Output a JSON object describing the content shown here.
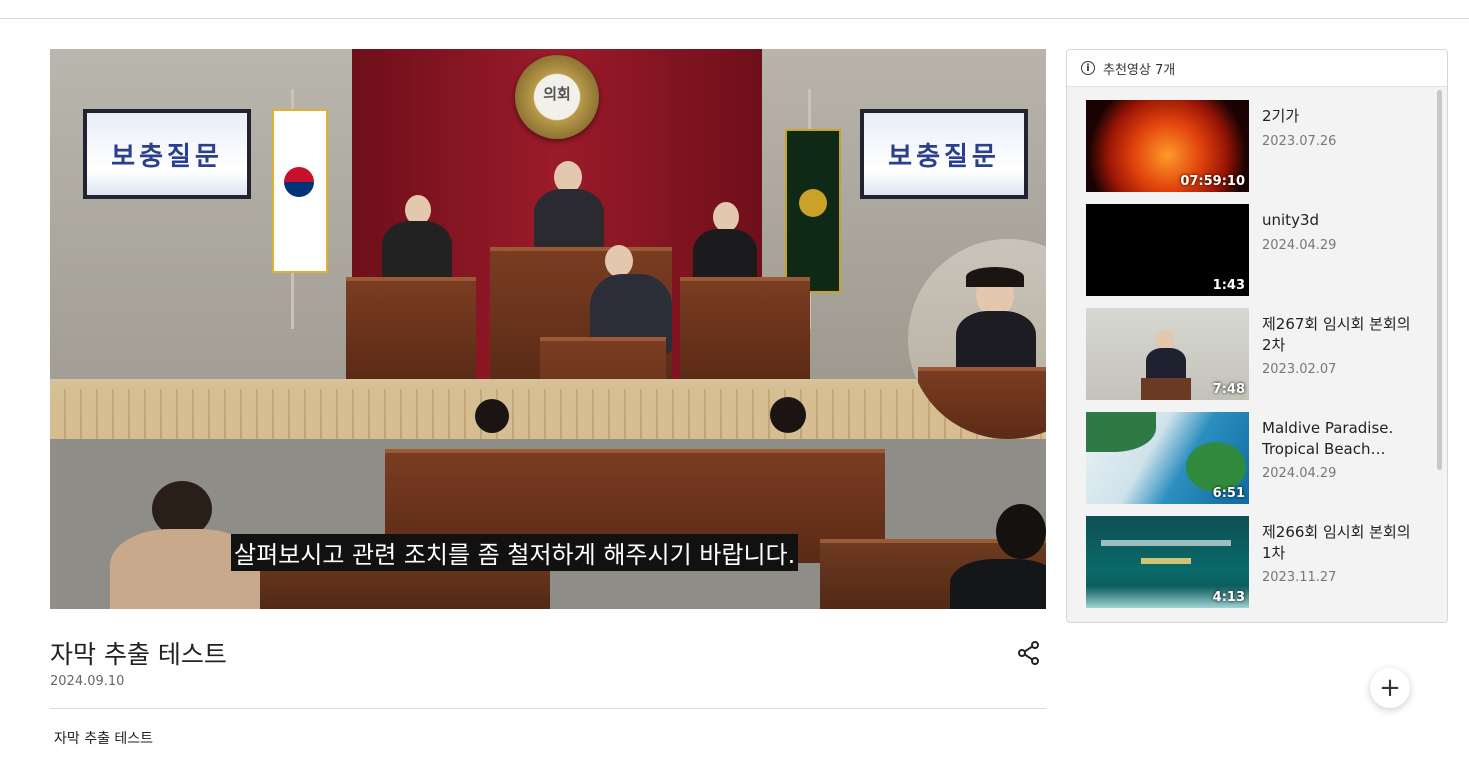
{
  "video": {
    "subtitle": "살펴보시고 관련 조치를 좀 철저하게 해주시기 바랍니다.",
    "scene_screen_text": "보충질문",
    "scene_emblem_text": "의회",
    "title": "자막 추출 테스트",
    "date": "2024.09.10",
    "description": "자막 추출 테스트"
  },
  "recommended": {
    "header": "추천영상 7개",
    "items": [
      {
        "title": "2기가",
        "date": "2023.07.26",
        "duration": "07:59:10",
        "thumb": "sun"
      },
      {
        "title": "unity3d",
        "date": "2024.04.29",
        "duration": "1:43",
        "thumb": "black"
      },
      {
        "title": "제267회 임시회 본회의 2차",
        "date": "2023.02.07",
        "duration": "7:48",
        "thumb": "council"
      },
      {
        "title": "Maldive Paradise. Tropical Beach…",
        "date": "2024.04.29",
        "duration": "6:51",
        "thumb": "beach"
      },
      {
        "title": "제266회 임시회 본회의 1차",
        "date": "2023.11.27",
        "duration": "4:13",
        "thumb": "teal"
      }
    ]
  },
  "icons": {
    "share": "share-icon",
    "info": "info-icon",
    "add": "plus-icon"
  }
}
